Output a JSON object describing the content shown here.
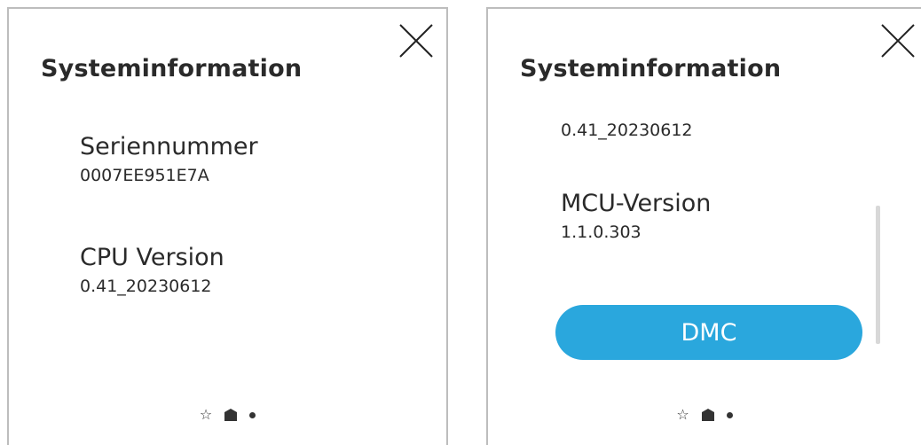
{
  "left_panel": {
    "title": "Systeminformation",
    "close_icon": "close-icon",
    "items": [
      {
        "label": "Seriennummer",
        "value": "0007EE951E7A"
      },
      {
        "label": "CPU Version",
        "value": "0.41_20230612"
      }
    ],
    "pager": [
      "star-icon",
      "home-icon",
      "dot-icon"
    ]
  },
  "right_panel": {
    "title": "Systeminformation",
    "close_icon": "close-icon",
    "items": [
      {
        "label": "",
        "value": "0.41_20230612"
      },
      {
        "label": "MCU-Version",
        "value": "1.1.0.303"
      }
    ],
    "dmc_button_label": "DMC",
    "pager": [
      "star-icon",
      "home-icon",
      "dot-icon"
    ]
  },
  "colors": {
    "accent": "#2aa7dd",
    "text": "#2a2a2a",
    "border": "#bdbdbd"
  }
}
